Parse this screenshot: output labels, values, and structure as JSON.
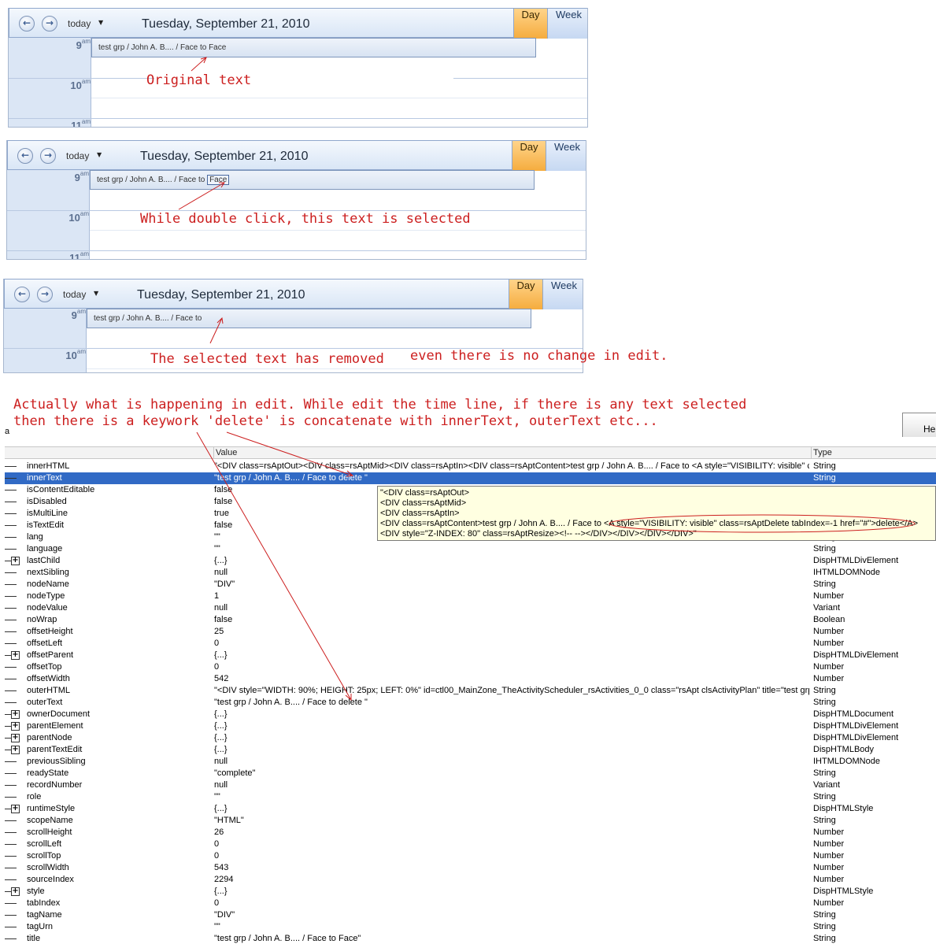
{
  "scheduler": {
    "today_label": "today",
    "date": "Tuesday, September 21, 2010",
    "day_label": "Day",
    "week_label": "Week",
    "hours": {
      "h9": "9",
      "h10": "10",
      "h11": "11",
      "suffix": "am"
    },
    "appointment_text": "test grp / John A. B.... / Face to Face",
    "appointment_text_prefix": "test grp / John A. B.... / Face to",
    "selected_word": "Face",
    "appointment_text_removed": "test grp / John A. B.... / Face to"
  },
  "notes": {
    "original": "Original text",
    "double_click": "While double click, this text is selected",
    "removed_a": "The selected text has removed",
    "removed_b": "even there is no change in edit.",
    "explain_line1": "Actually what is happening in edit. While edit the time line, if there is any text selected",
    "explain_line2": "then there is a keywork 'delete' is concatenate with innerText, outerText etc..."
  },
  "grid": {
    "left_fragment": "al",
    "help_label": "Hel",
    "columns": {
      "value": "Value",
      "type": "Type"
    },
    "rows": [
      {
        "name": "innerHTML",
        "value": "\"<DIV class=rsAptOut><DIV class=rsAptMid><DIV class=rsAptIn><DIV class=rsAptContent>test grp / John A. B.... / Face to <A style=\"VISIBILITY: visible\" class=rsAptDelete tabIndex=-1 href=\"#\">delete</A></DIV>",
        "type": "String",
        "expand": false
      },
      {
        "name": "innerText",
        "value": "\"test grp / John A. B.... / Face to delete \"",
        "type": "String",
        "expand": false,
        "selected": true
      },
      {
        "name": "isContentEditable",
        "value": "false",
        "type": "",
        "expand": false
      },
      {
        "name": "isDisabled",
        "value": "false",
        "type": "",
        "expand": false
      },
      {
        "name": "isMultiLine",
        "value": "true",
        "type": "",
        "expand": false
      },
      {
        "name": "isTextEdit",
        "value": "false",
        "type": "",
        "expand": false
      },
      {
        "name": "lang",
        "value": "\"\"",
        "type": "String",
        "expand": false
      },
      {
        "name": "language",
        "value": "\"\"",
        "type": "String",
        "expand": false
      },
      {
        "name": "lastChild",
        "value": "{...}",
        "type": "DispHTMLDivElement",
        "expand": true
      },
      {
        "name": "nextSibling",
        "value": "null",
        "type": "IHTMLDOMNode",
        "expand": false
      },
      {
        "name": "nodeName",
        "value": "\"DIV\"",
        "type": "String",
        "expand": false
      },
      {
        "name": "nodeType",
        "value": "1",
        "type": "Number",
        "expand": false
      },
      {
        "name": "nodeValue",
        "value": "null",
        "type": "Variant",
        "expand": false
      },
      {
        "name": "noWrap",
        "value": "false",
        "type": "Boolean",
        "expand": false
      },
      {
        "name": "offsetHeight",
        "value": "25",
        "type": "Number",
        "expand": false
      },
      {
        "name": "offsetLeft",
        "value": "0",
        "type": "Number",
        "expand": false
      },
      {
        "name": "offsetParent",
        "value": "{...}",
        "type": "DispHTMLDivElement",
        "expand": true
      },
      {
        "name": "offsetTop",
        "value": "0",
        "type": "Number",
        "expand": false
      },
      {
        "name": "offsetWidth",
        "value": "542",
        "type": "Number",
        "expand": false
      },
      {
        "name": "outerHTML",
        "value": "\"<DIV style=\"WIDTH: 90%; HEIGHT: 25px; LEFT: 0%\" id=ctl00_MainZone_TheActivityScheduler_rsActivities_0_0 class=\"rsApt clsActivityPlan\" title=\"test grp",
        "type": "String",
        "expand": false
      },
      {
        "name": "outerText",
        "value": "\"test grp / John A. B.... / Face to delete \"",
        "type": "String",
        "expand": false
      },
      {
        "name": "ownerDocument",
        "value": "{...}",
        "type": "DispHTMLDocument",
        "expand": true
      },
      {
        "name": "parentElement",
        "value": "{...}",
        "type": "DispHTMLDivElement",
        "expand": true
      },
      {
        "name": "parentNode",
        "value": "{...}",
        "type": "DispHTMLDivElement",
        "expand": true
      },
      {
        "name": "parentTextEdit",
        "value": "{...}",
        "type": "DispHTMLBody",
        "expand": true
      },
      {
        "name": "previousSibling",
        "value": "null",
        "type": "IHTMLDOMNode",
        "expand": false
      },
      {
        "name": "readyState",
        "value": "\"complete\"",
        "type": "String",
        "expand": false
      },
      {
        "name": "recordNumber",
        "value": "null",
        "type": "Variant",
        "expand": false
      },
      {
        "name": "role",
        "value": "\"\"",
        "type": "String",
        "expand": false
      },
      {
        "name": "runtimeStyle",
        "value": "{...}",
        "type": "DispHTMLStyle",
        "expand": true
      },
      {
        "name": "scopeName",
        "value": "\"HTML\"",
        "type": "String",
        "expand": false
      },
      {
        "name": "scrollHeight",
        "value": "26",
        "type": "Number",
        "expand": false
      },
      {
        "name": "scrollLeft",
        "value": "0",
        "type": "Number",
        "expand": false
      },
      {
        "name": "scrollTop",
        "value": "0",
        "type": "Number",
        "expand": false
      },
      {
        "name": "scrollWidth",
        "value": "543",
        "type": "Number",
        "expand": false
      },
      {
        "name": "sourceIndex",
        "value": "2294",
        "type": "Number",
        "expand": false
      },
      {
        "name": "style",
        "value": "{...}",
        "type": "DispHTMLStyle",
        "expand": true
      },
      {
        "name": "tabIndex",
        "value": "0",
        "type": "Number",
        "expand": false
      },
      {
        "name": "tagName",
        "value": "\"DIV\"",
        "type": "String",
        "expand": false
      },
      {
        "name": "tagUrn",
        "value": "\"\"",
        "type": "String",
        "expand": false
      },
      {
        "name": "title",
        "value": "\"test grp / John A. B.... / Face to Face\"",
        "type": "String",
        "expand": false
      }
    ],
    "tooltip_lines": [
      "\"<DIV class=rsAptOut>",
      "<DIV class=rsAptMid>",
      "<DIV class=rsAptIn>",
      "<DIV class=rsAptContent>test grp / John A. B.... / Face to <A style=\"VISIBILITY: visible\" class=rsAptDelete tabIndex=-1 href=\"#\">delete</A>",
      "<DIV style=\"Z-INDEX: 80\" class=rsAptResize><!-- --></DIV></DIV></DIV></DIV>\""
    ]
  }
}
